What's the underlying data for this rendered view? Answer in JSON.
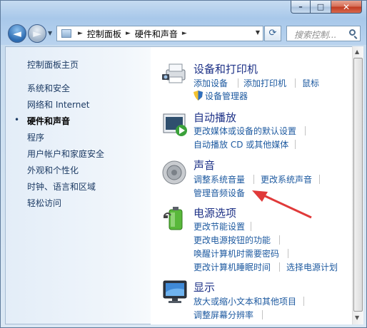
{
  "window": {
    "caption": {
      "minimize": "–",
      "maximize": "□",
      "close": "✕"
    }
  },
  "nav": {
    "back": "◄",
    "forward": "►"
  },
  "address": {
    "segments": [
      "控制面板",
      "硬件和声音"
    ]
  },
  "search": {
    "placeholder": "搜索控制..."
  },
  "sidebar": {
    "items": [
      {
        "label": "控制面板主页"
      },
      {
        "label": "系统和安全"
      },
      {
        "label": "网络和 Internet"
      },
      {
        "label": "硬件和声音"
      },
      {
        "label": "程序"
      },
      {
        "label": "用户帐户和家庭安全"
      },
      {
        "label": "外观和个性化"
      },
      {
        "label": "时钟、语言和区域"
      },
      {
        "label": "轻松访问"
      }
    ],
    "active_index": 3
  },
  "categories": [
    {
      "title": "设备和打印机",
      "icon": "printer-camera-icon",
      "tasks": [
        "添加设备",
        "添加打印机",
        "鼠标",
        "设备管理器"
      ]
    },
    {
      "title": "自动播放",
      "icon": "autoplay-icon",
      "tasks": [
        "更改媒体或设备的默认设置",
        "自动播放 CD 或其他媒体"
      ]
    },
    {
      "title": "声音",
      "icon": "speaker-icon",
      "tasks": [
        "调整系统音量",
        "更改系统声音",
        "管理音频设备"
      ]
    },
    {
      "title": "电源选项",
      "icon": "battery-icon",
      "tasks": [
        "更改节能设置",
        "更改电源按钮的功能",
        "唤醒计算机时需要密码",
        "更改计算机睡眠时间",
        "选择电源计划"
      ]
    },
    {
      "title": "显示",
      "icon": "monitor-icon",
      "tasks": [
        "放大或缩小文本和其他项目",
        "调整屏幕分辨率"
      ]
    }
  ],
  "colors": {
    "link": "#1e5aa0",
    "category": "#1e3287",
    "annotation_arrow": "#e03a3a"
  }
}
